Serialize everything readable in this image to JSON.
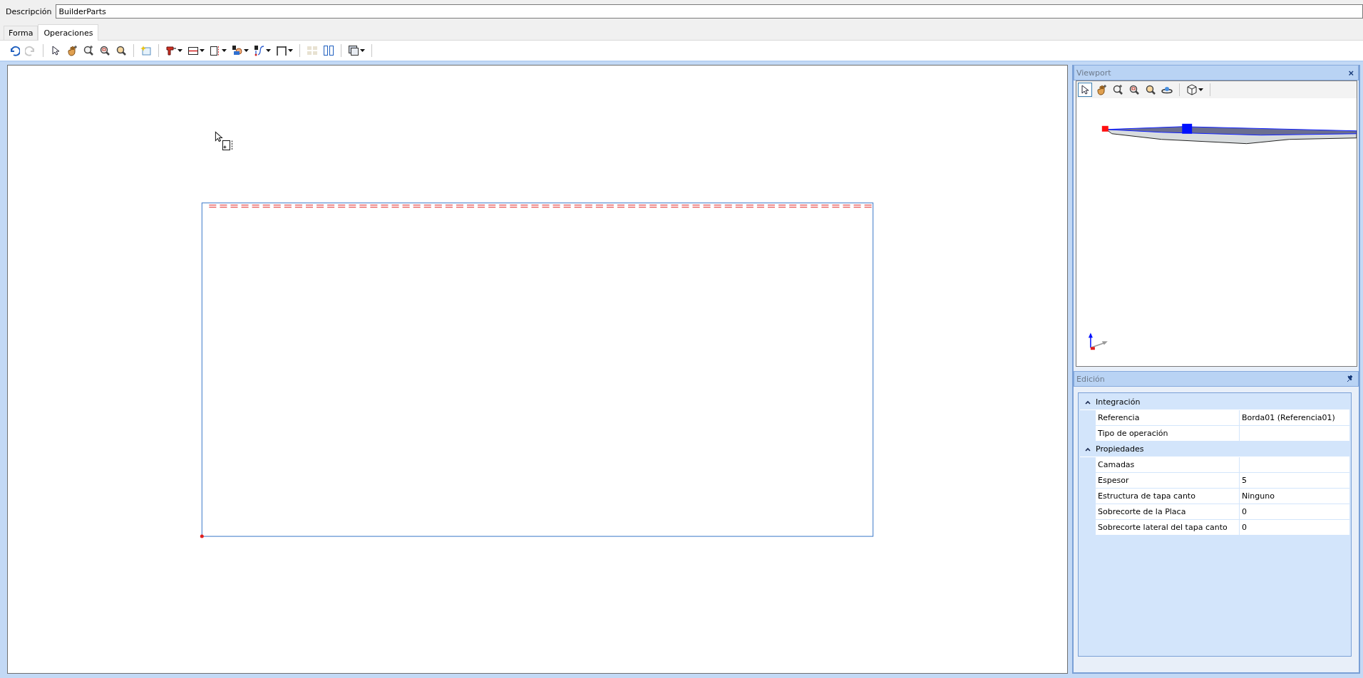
{
  "description": {
    "label": "Descripción",
    "value": "BuilderParts"
  },
  "tabs": [
    {
      "label": "Forma",
      "selected": false
    },
    {
      "label": "Operaciones",
      "selected": true
    }
  ],
  "toolbar": [
    {
      "kind": "undo",
      "disabled": false,
      "dropdown": false
    },
    {
      "kind": "redo",
      "disabled": true,
      "dropdown": false
    },
    {
      "kind": "separator"
    },
    {
      "kind": "pointer",
      "disabled": false,
      "dropdown": false
    },
    {
      "kind": "hand",
      "disabled": false,
      "dropdown": false
    },
    {
      "kind": "zoomplus",
      "disabled": false,
      "dropdown": false
    },
    {
      "kind": "zoomwindow",
      "disabled": false,
      "dropdown": false
    },
    {
      "kind": "zoomall",
      "disabled": false,
      "dropdown": false
    },
    {
      "kind": "separator"
    },
    {
      "kind": "newpanel",
      "disabled": false,
      "dropdown": false
    },
    {
      "kind": "separator"
    },
    {
      "kind": "drill",
      "disabled": false,
      "dropdown": true
    },
    {
      "kind": "hcut",
      "disabled": false,
      "dropdown": true
    },
    {
      "kind": "edge",
      "disabled": false,
      "dropdown": true
    },
    {
      "kind": "pocket",
      "disabled": false,
      "dropdown": true
    },
    {
      "kind": "path",
      "disabled": false,
      "dropdown": true
    },
    {
      "kind": "dimension",
      "disabled": false,
      "dropdown": true
    },
    {
      "kind": "separator"
    },
    {
      "kind": "blocks",
      "disabled": true,
      "dropdown": false
    },
    {
      "kind": "columns",
      "disabled": false,
      "dropdown": false
    },
    {
      "kind": "separator"
    },
    {
      "kind": "windows",
      "disabled": false,
      "dropdown": true
    },
    {
      "kind": "separator"
    }
  ],
  "viewport": {
    "title": "Viewport",
    "close": "×",
    "toolbar": [
      {
        "kind": "pointer",
        "selected": true,
        "dropdown": false
      },
      {
        "kind": "hand",
        "selected": false,
        "dropdown": false
      },
      {
        "kind": "zoomplus",
        "selected": false,
        "dropdown": false
      },
      {
        "kind": "zoomwindow",
        "selected": false,
        "dropdown": false
      },
      {
        "kind": "zoomall",
        "selected": false,
        "dropdown": false
      },
      {
        "kind": "orbit",
        "selected": false,
        "dropdown": false
      },
      {
        "kind": "separator"
      },
      {
        "kind": "cube",
        "selected": false,
        "dropdown": true
      },
      {
        "kind": "separator"
      }
    ]
  },
  "edicion": {
    "title": "Edición",
    "categories": [
      {
        "name": "Integración",
        "expanded": true,
        "rows": [
          {
            "name": "Referencia",
            "value": "Borda01 (Referencia01)"
          },
          {
            "name": "Tipo de operación"
          }
        ]
      },
      {
        "name": "Propiedades",
        "expanded": true,
        "rows": [
          {
            "name": "Camadas"
          },
          {
            "name": "Espesor",
            "value": "5"
          },
          {
            "name": "Estructura de tapa canto",
            "value": "Ninguno"
          },
          {
            "name": "Sobrecorte de la Placa",
            "value": "0"
          },
          {
            "name": "Sobrecorte lateral del tapa canto",
            "value": "0"
          }
        ]
      }
    ]
  }
}
